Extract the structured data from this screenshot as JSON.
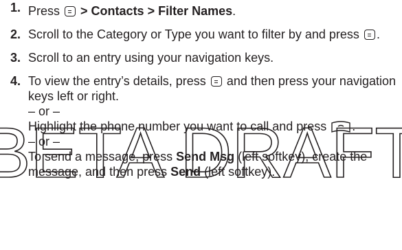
{
  "watermark_text": "BETA DRAFT",
  "icons": {
    "menu_ok_key": "menu-ok-key-icon",
    "talk_key": "talk-key-icon"
  },
  "steps": [
    {
      "num": "1.",
      "t1": "Press",
      "t2": "> Contacts > Filter Names",
      "t3": "."
    },
    {
      "num": "2.",
      "t1": "Scroll to the Category or Type you want to filter by and press",
      "t2": "."
    },
    {
      "num": "3.",
      "t1": "Scroll to an entry using your navigation keys."
    },
    {
      "num": "4.",
      "t1": "To view the entry’s details, press",
      "t2": "and then press your navigation keys left or right.",
      "or1": "– or –",
      "call_t1": "Highlight the phone number you want to call and press",
      "call_t2": ".",
      "or2": "– or –",
      "msg_t1": "To send a message, press",
      "msg_b1": "Send Msg",
      "msg_t2": "(left softkey), create the message, and then press",
      "msg_b2": "Send",
      "msg_t3": "(left softkey)."
    }
  ]
}
